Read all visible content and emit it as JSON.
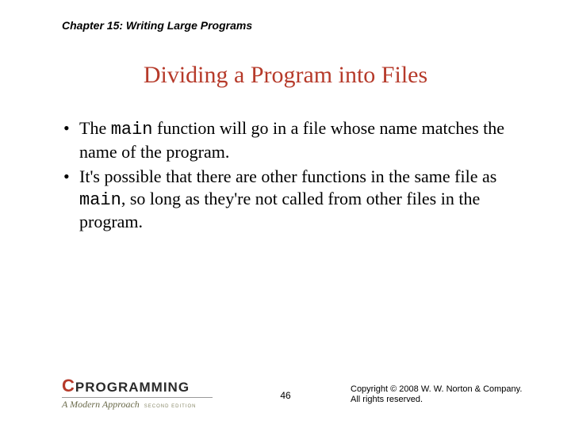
{
  "header": {
    "chapter": "Chapter 15: Writing Large Programs"
  },
  "title": "Dividing a Program into Files",
  "bullets": [
    {
      "pre": "The ",
      "code": "main",
      "post": " function will go in a file whose name matches the name of the program."
    },
    {
      "pre": "It's possible that there are other functions in the same file as ",
      "code": "main",
      "post": ", so long as they're not called from other files in the program."
    }
  ],
  "footer": {
    "logo": {
      "c": "C",
      "prog": "PROGRAMMING",
      "modern": "A Modern Approach",
      "edition": "SECOND EDITION"
    },
    "page": "46",
    "copyright_line1": "Copyright © 2008 W. W. Norton & Company.",
    "copyright_line2": "All rights reserved."
  }
}
